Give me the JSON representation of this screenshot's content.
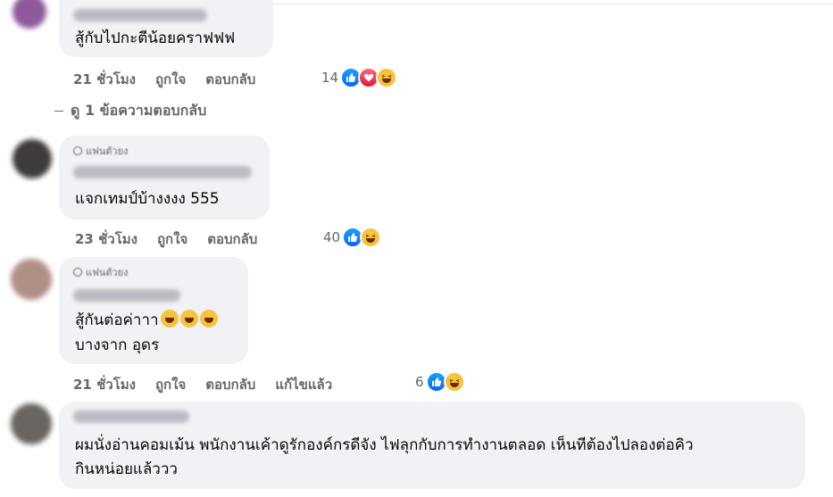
{
  "comments": [
    {
      "text_lines": [
        "สู้กับไปกะตีน้อยคราฟฟฟ"
      ],
      "time": "21 ชั่วโมง",
      "like_label": "ถูกใจ",
      "reply_label": "ตอบกลับ",
      "edited_label": "",
      "reaction_count": "14",
      "reactions": [
        "like-icon",
        "love-icon",
        "haha-icon"
      ]
    },
    {
      "fan_badge": "แฟนตัวยง",
      "text_lines": [
        "แจกเทมป์บ้างงงง 555"
      ],
      "time": "23 ชั่วโมง",
      "like_label": "ถูกใจ",
      "reply_label": "ตอบกลับ",
      "reaction_count": "40",
      "reactions": [
        "like-icon",
        "haha-icon"
      ]
    },
    {
      "fan_badge": "แฟนตัวยง",
      "text_lines": [
        "สู้กันต่อค่าาา",
        "บางจาก อุดร"
      ],
      "emoji": [
        "rofl-emoji",
        "rofl-emoji",
        "rofl-emoji"
      ],
      "time": "21 ชั่วโมง",
      "like_label": "ถูกใจ",
      "reply_label": "ตอบกลับ",
      "edited_label": "แก้ไขแล้ว",
      "reaction_count": "6",
      "reactions": [
        "like-icon",
        "haha-icon"
      ]
    },
    {
      "text_lines": [
        "ผมนั่งอ่านคอมเม้น พนักงานเค้าดูรักองค์กรดีจัง ไฟลุกกับการทำงานตลอด เห็นทีต้องไปลองต่อคิว",
        "กินหน่อยแล้ววว"
      ]
    }
  ],
  "view_replies": "ดู 1 ข้อความตอบกลับ",
  "colors": {
    "like": "#0866ff",
    "love": "#f33e58",
    "haha": "#f9c23c",
    "bubble": "#f0f2f5",
    "meta": "#65676b"
  }
}
